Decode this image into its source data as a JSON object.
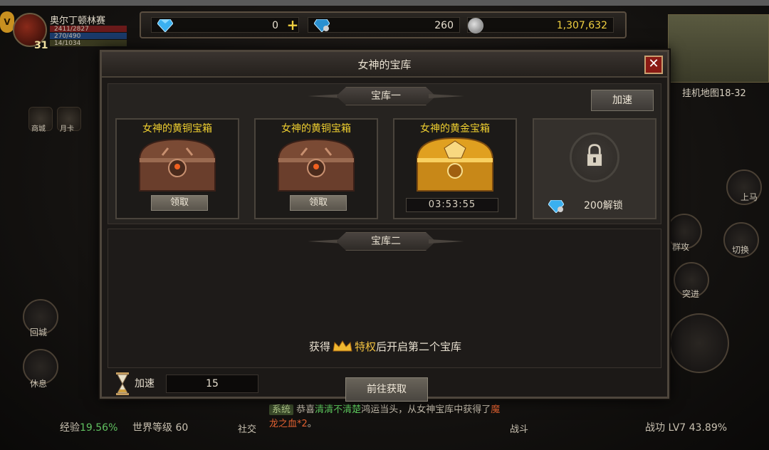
{
  "player": {
    "name": "奥尔丁顿林赛",
    "level": "31",
    "hp": "2411/2827",
    "mp": "270/490",
    "exp": "14/1034"
  },
  "currency": {
    "diamond": "0",
    "bound_diamond": "260",
    "silver": "1,307,632"
  },
  "map": {
    "name": "挂机地图18-32"
  },
  "side_left": [
    "商城",
    "月卡",
    "回城",
    "休息"
  ],
  "side_right": [
    "上马",
    "群攻",
    "切换",
    "突进"
  ],
  "bottom": {
    "exp_label": "经验",
    "exp_pct": "19.56%",
    "world_level": "世界等级 60",
    "social": "社交",
    "battle": "战斗",
    "power": "战功 LV7  43.89%"
  },
  "chat": {
    "tag": "系统",
    "text_before": "恭喜",
    "player_name": "清清不清楚",
    "text_mid": "鸿运当头，从女神宝库中获得了",
    "item": "魔龙之血*2",
    "text_after": "。"
  },
  "modal": {
    "title": "女神的宝库",
    "close": "✕",
    "vault1": {
      "title": "宝库一",
      "speed_button": "加速",
      "chests": [
        {
          "name": "女神的黄铜宝箱",
          "action": "领取",
          "type": "bronze"
        },
        {
          "name": "女神的黄铜宝箱",
          "action": "领取",
          "type": "bronze"
        },
        {
          "name": "女神的黄金宝箱",
          "timer": "03:53:55",
          "type": "gold"
        }
      ],
      "locked": {
        "cost": "200解锁"
      }
    },
    "vault2": {
      "title": "宝库二",
      "line_before": "获得",
      "line_gold": "特权",
      "line_after": "后开启第二个宝库",
      "goto_button": "前往获取"
    },
    "speed_item": {
      "label": "加速",
      "count": "15"
    }
  },
  "colors": {
    "accent_gold": "#f0d030",
    "close_red": "#8a1a14",
    "panel_bg": "#1c1917"
  }
}
